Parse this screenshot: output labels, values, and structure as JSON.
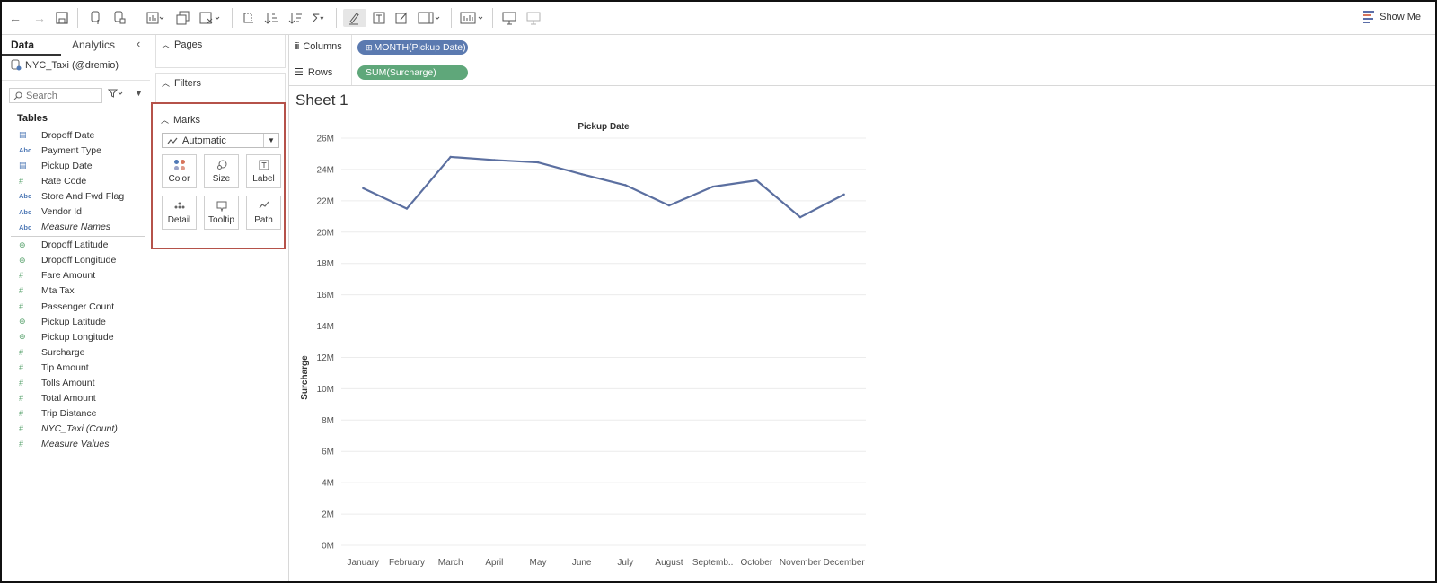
{
  "toolbar": {
    "icons": [
      "back-arrow-icon",
      "forward-arrow-icon",
      "save-icon",
      "new-datasource-icon",
      "pause-updates-icon",
      "new-worksheet-icon",
      "duplicate-sheet-icon",
      "clear-sheet-icon",
      "swap-icon",
      "sort-ascending-icon",
      "sort-descending-icon",
      "totals-icon",
      "highlight-icon",
      "text-label-icon",
      "annotate-icon",
      "fit-icon",
      "show-cards-icon",
      "presentation-icon",
      "device-preview-icon"
    ],
    "show_me_label": "Show Me"
  },
  "data_pane": {
    "tab_data": "Data",
    "tab_analytics": "Analytics",
    "collapse_glyph": "‹",
    "datasource_name": "NYC_Taxi (@dremio)",
    "search_placeholder": "Search",
    "tables_header": "Tables",
    "dimensions": [
      {
        "icon": "date",
        "glyph": "▤",
        "label": "Dropoff Date"
      },
      {
        "icon": "abc",
        "glyph": "Abc",
        "label": "Payment Type"
      },
      {
        "icon": "date",
        "glyph": "▤",
        "label": "Pickup Date"
      },
      {
        "icon": "num",
        "glyph": "#",
        "label": "Rate Code"
      },
      {
        "icon": "abc",
        "glyph": "Abc",
        "label": "Store And Fwd Flag"
      },
      {
        "icon": "abc",
        "glyph": "Abc",
        "label": "Vendor Id"
      },
      {
        "icon": "abc",
        "glyph": "Abc",
        "label": "Measure Names",
        "italic": true
      }
    ],
    "measures": [
      {
        "icon": "geo",
        "glyph": "⊕",
        "label": "Dropoff Latitude"
      },
      {
        "icon": "geo",
        "glyph": "⊕",
        "label": "Dropoff Longitude"
      },
      {
        "icon": "num",
        "glyph": "#",
        "label": "Fare Amount"
      },
      {
        "icon": "num",
        "glyph": "#",
        "label": "Mta Tax"
      },
      {
        "icon": "num",
        "glyph": "#",
        "label": "Passenger Count"
      },
      {
        "icon": "geo",
        "glyph": "⊕",
        "label": "Pickup Latitude"
      },
      {
        "icon": "geo",
        "glyph": "⊕",
        "label": "Pickup Longitude"
      },
      {
        "icon": "num",
        "glyph": "#",
        "label": "Surcharge"
      },
      {
        "icon": "num",
        "glyph": "#",
        "label": "Tip Amount"
      },
      {
        "icon": "num",
        "glyph": "#",
        "label": "Tolls Amount"
      },
      {
        "icon": "num",
        "glyph": "#",
        "label": "Total Amount"
      },
      {
        "icon": "num",
        "glyph": "#",
        "label": "Trip Distance"
      },
      {
        "icon": "num",
        "glyph": "#",
        "label": "NYC_Taxi (Count)",
        "italic": true
      },
      {
        "icon": "num",
        "glyph": "#",
        "label": "Measure Values",
        "italic": true
      }
    ]
  },
  "cards": {
    "pages_title": "Pages",
    "filters_title": "Filters",
    "marks_title": "Marks",
    "mark_type": "Automatic",
    "mark_buttons": {
      "color": "Color",
      "size": "Size",
      "label": "Label",
      "detail": "Detail",
      "tooltip": "Tooltip",
      "path": "Path"
    }
  },
  "shelves": {
    "columns_label": "Columns",
    "columns_pill": "MONTH(Pickup Date)",
    "rows_label": "Rows",
    "rows_pill": "SUM(Surcharge)"
  },
  "colors": {
    "line": "#5b6fa0",
    "pill_dimension": "#5b7ab0",
    "pill_measure": "#5fa77a",
    "highlight_border": "#b5524a"
  },
  "sheet": {
    "title": "Sheet 1"
  },
  "chart_data": {
    "type": "line",
    "title": "Pickup Date",
    "xlabel": "",
    "ylabel": "Surcharge",
    "categories": [
      "January",
      "February",
      "March",
      "April",
      "May",
      "June",
      "July",
      "August",
      "Septemb..",
      "October",
      "November",
      "December"
    ],
    "values": [
      22800000,
      21500000,
      24800000,
      24600000,
      24450000,
      23700000,
      23000000,
      21700000,
      22900000,
      23300000,
      20950000,
      22400000
    ],
    "ylim": [
      0,
      26000000
    ],
    "yticks": [
      "0M",
      "2M",
      "4M",
      "6M",
      "8M",
      "10M",
      "12M",
      "14M",
      "16M",
      "18M",
      "20M",
      "22M",
      "24M",
      "26M"
    ],
    "grid": true
  }
}
